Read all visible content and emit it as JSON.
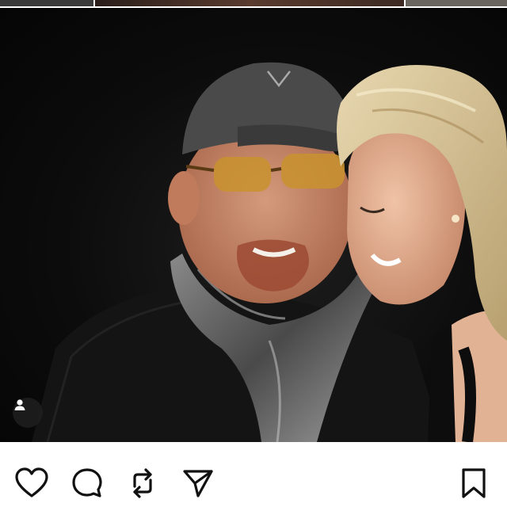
{
  "post": {
    "image_description_icon": "tagged-people-icon"
  },
  "actions": {
    "like_icon": "heart-icon",
    "comment_icon": "comment-bubble-icon",
    "repost_icon": "repost-icon",
    "share_icon": "send-icon",
    "save_icon": "bookmark-icon"
  },
  "colors": {
    "background": "#ffffff",
    "icon": "#111111",
    "photo_bg": "#0a0a0a"
  }
}
